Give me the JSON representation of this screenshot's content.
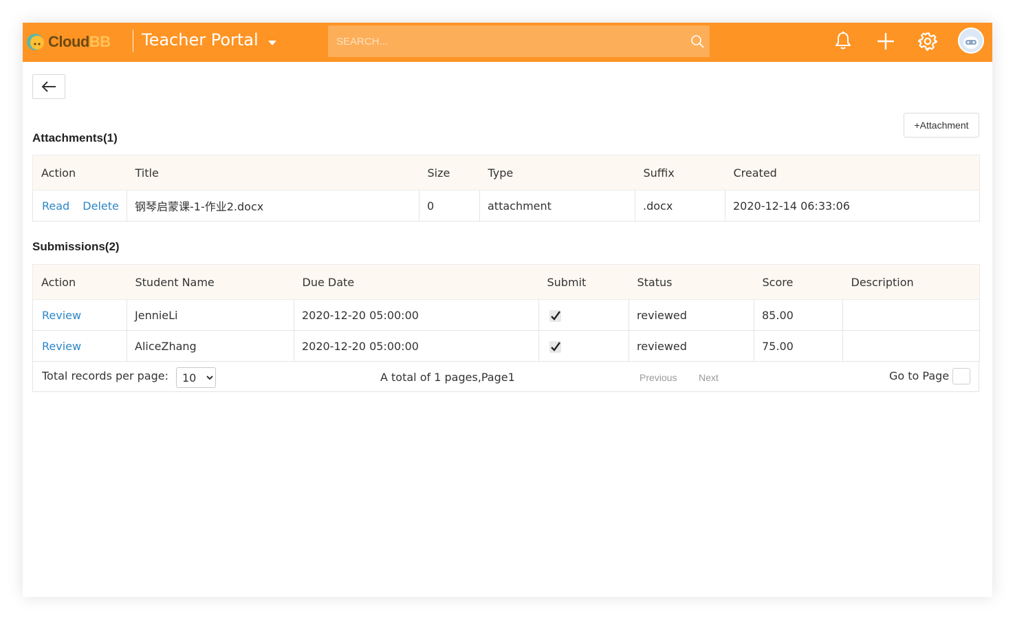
{
  "header": {
    "logo_cloud": "Cloud",
    "logo_bb": "BB",
    "portal_title": "Teacher Portal",
    "search_placeholder": "SEARCH...",
    "icons": [
      "bell-icon",
      "plus-icon",
      "gear-icon",
      "avatar"
    ]
  },
  "attachments": {
    "heading": "Attachments(1)",
    "add_button": "+Attachment",
    "columns": [
      "Action",
      "Title",
      "Size",
      "Type",
      "Suffix",
      "Created"
    ],
    "rows": [
      {
        "actions": [
          "Read",
          "Delete"
        ],
        "title": "钢琴启蒙课-1-作业2.docx",
        "size": "0",
        "type": "attachment",
        "suffix": ".docx",
        "created": "2020-12-14 06:33:06"
      }
    ]
  },
  "submissions": {
    "heading": "Submissions(2)",
    "columns": [
      "Action",
      "Student Name",
      "Due Date",
      "Submit",
      "Status",
      "Score",
      "Description"
    ],
    "rows": [
      {
        "action": "Review",
        "student": "JennieLi",
        "due": "2020-12-20 05:00:00",
        "submit": "✔",
        "status": "reviewed",
        "score": "85.00",
        "description": ""
      },
      {
        "action": "Review",
        "student": "AliceZhang",
        "due": "2020-12-20 05:00:00",
        "submit": "✔",
        "status": "reviewed",
        "score": "75.00",
        "description": ""
      }
    ]
  },
  "pager": {
    "per_page_label": "Total records per page:",
    "per_page_value": "10",
    "total_text": "A total of 1 pages,Page1",
    "previous": "Previous",
    "next": "Next",
    "goto_label": "Go to Page"
  },
  "colors": {
    "topbar": "#fe9424",
    "search": "#fcae59",
    "link": "#2d86c6",
    "table_header": "#fdf8f2"
  }
}
